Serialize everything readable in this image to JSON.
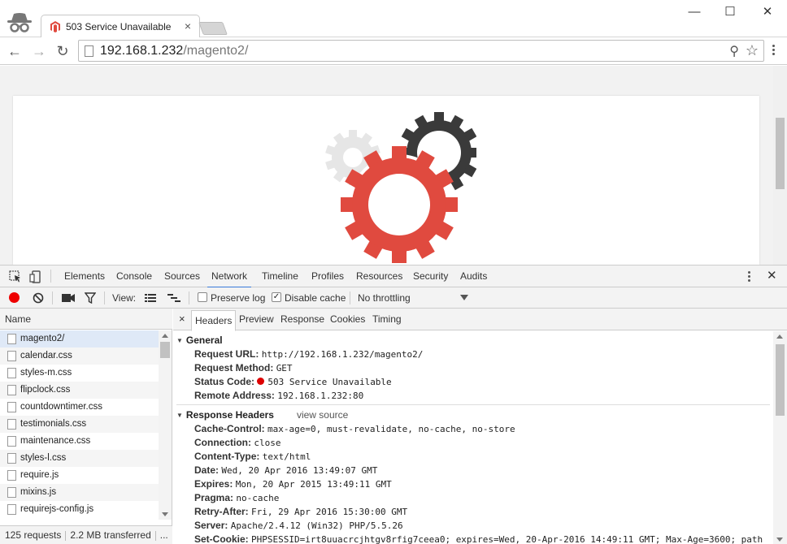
{
  "tab": {
    "title": "503 Service Unavailable",
    "favicon": "magento-favicon-icon",
    "close": "×"
  },
  "window_controls": {
    "minimize": "—",
    "maximize": "☐",
    "close": "✕"
  },
  "nav": {
    "back": "←",
    "forward": "→",
    "reload": "↻"
  },
  "omnibox": {
    "host": "192.168.1.232",
    "path": "/magento2/",
    "zoom": "⚲",
    "star": "☆"
  },
  "page": {
    "illustration": "gears-image"
  },
  "devtools": {
    "tabs": [
      "Elements",
      "Console",
      "Sources",
      "Network",
      "Timeline",
      "Profiles",
      "Resources",
      "Security",
      "Audits"
    ],
    "active_tab": "Network",
    "close": "✕",
    "network_bar": {
      "view_label": "View:",
      "preserve_log": "Preserve log",
      "disable_cache": "Disable cache",
      "throttling": "No throttling",
      "preserve_checked": false,
      "disable_cache_checked": true
    },
    "request_list": {
      "column_name": "Name",
      "rows": [
        "magento2/",
        "calendar.css",
        "styles-m.css",
        "flipclock.css",
        "countdowntimer.css",
        "testimonials.css",
        "maintenance.css",
        "styles-l.css",
        "require.js",
        "mixins.js",
        "requirejs-config.js"
      ],
      "selected": "magento2/"
    },
    "status": {
      "requests": "125 requests",
      "transferred": "2.2 MB transferred",
      "more": "..."
    },
    "details": {
      "close": "×",
      "tabs": [
        "Headers",
        "Preview",
        "Response",
        "Cookies",
        "Timing"
      ],
      "active_tab": "Headers",
      "general": {
        "title": "General",
        "items": [
          {
            "k": "Request URL:",
            "v": "http://192.168.1.232/magento2/"
          },
          {
            "k": "Request Method:",
            "v": "GET"
          },
          {
            "k": "Status Code:",
            "v": "503 Service Unavailable"
          },
          {
            "k": "Remote Address:",
            "v": "192.168.1.232:80"
          }
        ]
      },
      "response_headers": {
        "title": "Response Headers",
        "view_source": "view source",
        "items": [
          {
            "k": "Cache-Control:",
            "v": "max-age=0, must-revalidate, no-cache, no-store"
          },
          {
            "k": "Connection:",
            "v": "close"
          },
          {
            "k": "Content-Type:",
            "v": "text/html"
          },
          {
            "k": "Date:",
            "v": "Wed, 20 Apr 2016 13:49:07 GMT"
          },
          {
            "k": "Expires:",
            "v": "Mon, 20 Apr 2015 13:49:11 GMT"
          },
          {
            "k": "Pragma:",
            "v": "no-cache"
          },
          {
            "k": "Retry-After:",
            "v": "Fri, 29 Apr 2016 15:30:00 GMT"
          },
          {
            "k": "Server:",
            "v": "Apache/2.4.12 (Win32) PHP/5.5.26"
          },
          {
            "k": "Set-Cookie:",
            "v": "PHPSESSID=irt8uuacrcjhtgv8rfig7ceea0; expires=Wed, 20-Apr-2016 14:49:11 GMT; Max-Age=3600; path"
          }
        ]
      }
    }
  },
  "colors": {
    "accent": "#3879d9",
    "magento_red": "#e04a3f",
    "gear_dark": "#3a3a3a",
    "gear_light": "#e6e6e6",
    "status_red": "#dd0000"
  }
}
